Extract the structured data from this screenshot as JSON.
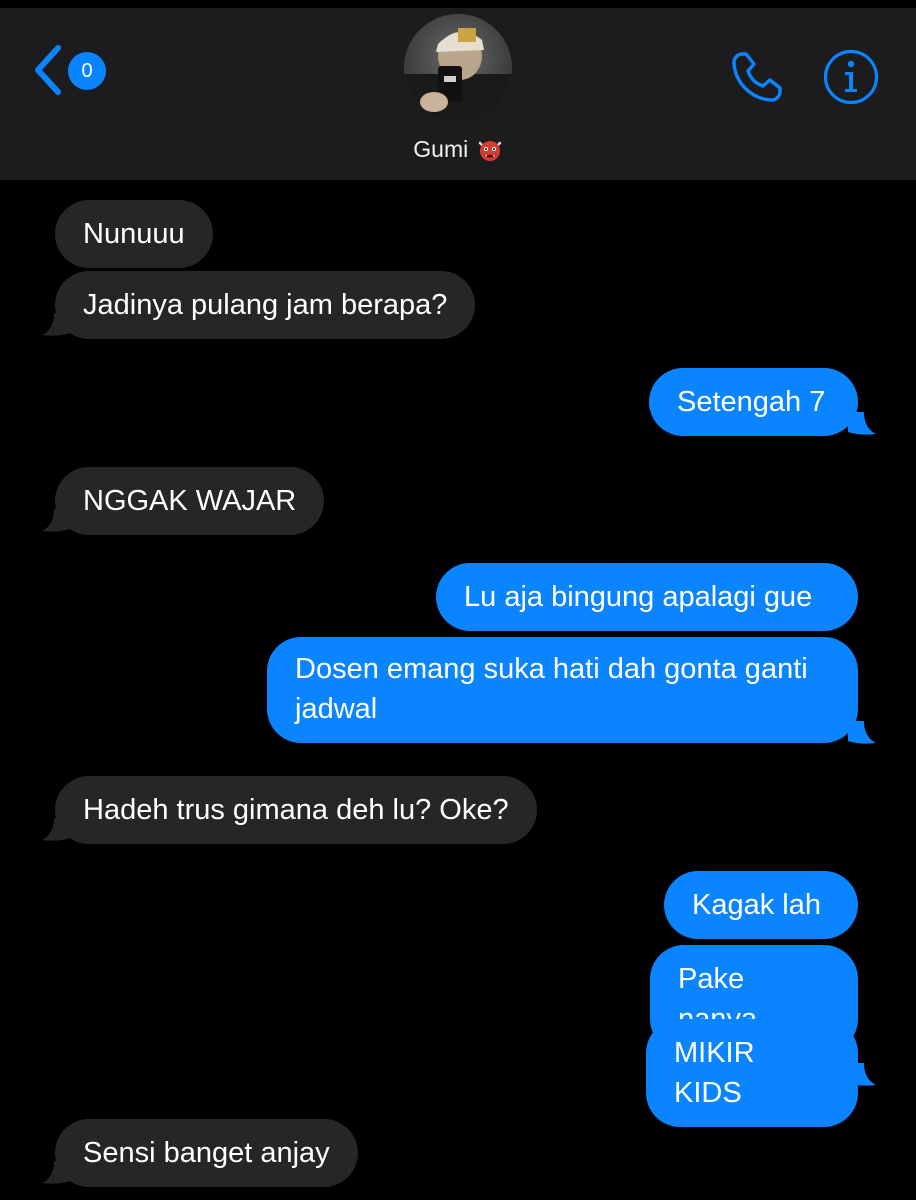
{
  "header": {
    "unread_count": "0",
    "contact_name": "Gumi",
    "contact_emoji_icon": "ogre-emoji-icon",
    "back_icon": "chevron-left-icon",
    "phone_icon": "phone-icon",
    "info_icon": "info-icon",
    "accent_color": "#0a84ff"
  },
  "messages": [
    {
      "direction": "incoming",
      "text": "Nunuuu"
    },
    {
      "direction": "incoming",
      "text": "Jadinya pulang jam berapa?"
    },
    {
      "direction": "outgoing",
      "text": "Setengah 7"
    },
    {
      "direction": "incoming",
      "text": "NGGAK WAJAR"
    },
    {
      "direction": "outgoing",
      "text": "Lu aja bingung apalagi gue"
    },
    {
      "direction": "outgoing",
      "text": "Dosen emang suka hati dah gonta ganti jadwal"
    },
    {
      "direction": "incoming",
      "text": "Hadeh trus gimana deh lu? Oke?"
    },
    {
      "direction": "outgoing",
      "text": "Kagak lah"
    },
    {
      "direction": "outgoing",
      "text": "Pake nanya"
    },
    {
      "direction": "outgoing",
      "text": "MIKIR KIDS"
    },
    {
      "direction": "incoming",
      "text": "Sensi banget anjay"
    }
  ]
}
